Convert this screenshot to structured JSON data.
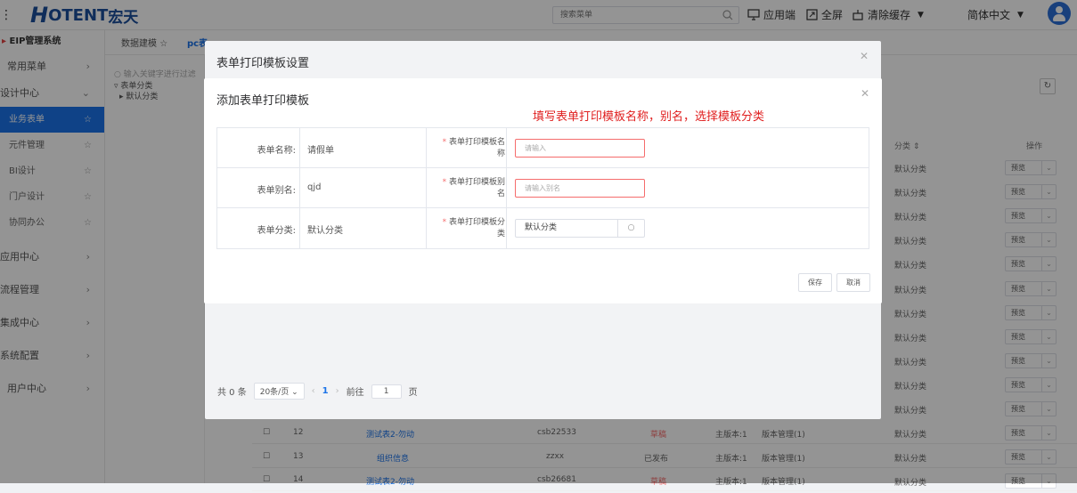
{
  "header": {
    "logo_h": "H",
    "logo_text": "OTENT",
    "logo_cn": "宏天",
    "search_placeholder": "搜索菜单",
    "app_end": "应用端",
    "fullscreen": "全屏",
    "clear_cache": "清除缓存",
    "language": "简体中文"
  },
  "sidebar": {
    "system_name": "EIP管理系统",
    "items": [
      {
        "label": "常用菜单"
      },
      {
        "label": "设计中心"
      }
    ],
    "sub_items": [
      {
        "label": "业务表单"
      },
      {
        "label": "元件管理"
      },
      {
        "label": "BI设计"
      },
      {
        "label": "门户设计"
      },
      {
        "label": "协同办公"
      }
    ],
    "bottom_items": [
      {
        "label": "应用中心"
      },
      {
        "label": "流程管理"
      },
      {
        "label": "集成中心"
      },
      {
        "label": "系统配置"
      },
      {
        "label": "用户中心"
      }
    ]
  },
  "tabs": {
    "tab1": "数据建模",
    "tab2": "pc表"
  },
  "tree": {
    "search_placeholder": "输入关键字进行过滤",
    "root": "表单分类",
    "child": "默认分类"
  },
  "right_table": {
    "col_category": "分类",
    "col_action": "操作",
    "row_category": "默认分类",
    "row_action": "预览"
  },
  "bottom_rows": [
    {
      "no": "12",
      "name": "测试表2-勿动",
      "key": "csb22533",
      "status": "草稿",
      "ver": "主版本:1",
      "mgr": "版本管理(1)"
    },
    {
      "no": "13",
      "name": "组织信息",
      "key": "zzxx",
      "status": "已发布",
      "ver": "主版本:1",
      "mgr": "版本管理(1)"
    },
    {
      "no": "14",
      "name": "测试表2-勿动",
      "key": "csb26681",
      "status": "草稿",
      "ver": "主版本:1",
      "mgr": "版本管理(1)"
    }
  ],
  "dialog1": {
    "title": "表单打印模板设置",
    "pager_total": "共 0 条",
    "pager_size": "20条/页",
    "pager_page": "1",
    "pager_goto": "前往",
    "pager_goto_value": "1",
    "pager_unit": "页"
  },
  "dialog2": {
    "title": "添加表单打印模板",
    "annotation": "填写表单打印模板名称，别名，选择模板分类",
    "rows": [
      {
        "label": "表单名称:",
        "value": "请假单",
        "plabel": "表单打印模板名称",
        "input_placeholder": "请输入"
      },
      {
        "label": "表单别名:",
        "value": "qjd",
        "plabel": "表单打印模板别名",
        "input_placeholder": "请输入别名"
      },
      {
        "label": "表单分类:",
        "value": "默认分类",
        "plabel": "表单打印模板分类",
        "select_value": "默认分类"
      }
    ],
    "save": "保存",
    "cancel": "取消"
  },
  "colors": {
    "accent": "#1b73e8",
    "error": "#f56c6c",
    "annotation": "#e02020"
  }
}
